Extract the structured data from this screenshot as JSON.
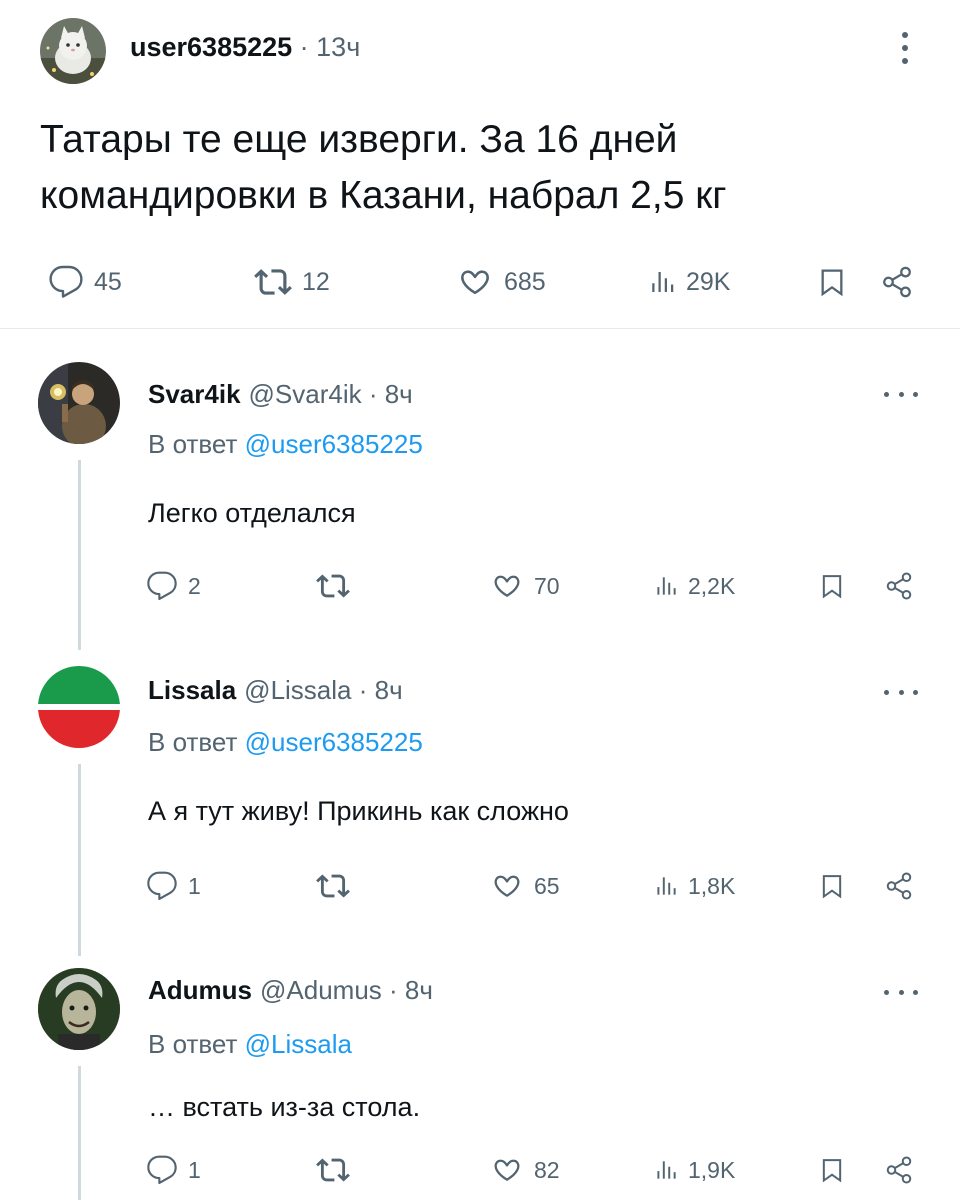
{
  "post": {
    "username": "user6385225",
    "time": "· 13ч",
    "text": "Татары те еще изверги. За 16 дней командировки в Казани, набрал 2,5 кг",
    "stats": {
      "replies": "45",
      "reposts": "12",
      "likes": "685",
      "views": "29K"
    },
    "icons": [
      "avatar",
      "more-vertical-icon",
      "reply-icon",
      "repost-icon",
      "like-icon",
      "views-icon",
      "bookmark-icon",
      "share-icon"
    ]
  },
  "replies": [
    {
      "name": "Svar4ik",
      "meta": "@Svar4ik · 8ч",
      "reply_prefix": "В ответ",
      "reply_to": "@user6385225",
      "text": "Легко отделался",
      "stats": {
        "replies": "2",
        "reposts": "",
        "likes": "70",
        "views": "2,2K"
      }
    },
    {
      "name": "Lissala",
      "meta": "@Lissala · 8ч",
      "reply_prefix": "В ответ",
      "reply_to": "@user6385225",
      "text": "А я тут живу! Прикинь как сложно",
      "stats": {
        "replies": "1",
        "reposts": "",
        "likes": "65",
        "views": "1,8K"
      },
      "avatar_colors": {
        "top": "#1a9b4b",
        "middle": "#ffffff",
        "bottom": "#e0272b"
      }
    },
    {
      "name": "Adumus",
      "meta": "@Adumus · 8ч",
      "reply_prefix": "В ответ",
      "reply_to": "@Lissala",
      "text": "… встать из-за стола.",
      "stats": {
        "replies": "1",
        "reposts": "",
        "likes": "82",
        "views": "1,9K"
      }
    }
  ],
  "colors": {
    "text": "#0f1419",
    "secondary": "#536471",
    "mention": "#1d9bf0",
    "divider": "#e7e9ea",
    "thread_line": "#cfd9de"
  }
}
